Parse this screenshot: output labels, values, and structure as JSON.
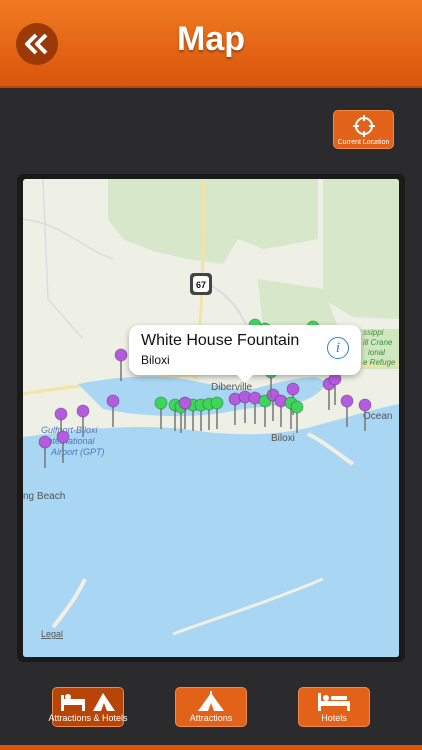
{
  "header": {
    "title": "Map",
    "back_icon": "double-chevron-left-icon"
  },
  "toolbar": {
    "current_location_label": "Current Location",
    "current_location_icon": "crosshair-icon"
  },
  "map": {
    "labels": {
      "highway": "67",
      "diberville": "Diberville",
      "biloxi": "Biloxi",
      "airport_line1": "Gulfport-Biloxi",
      "airport_line2": "International",
      "airport_line3": "Airport (GPT)",
      "long_beach": "ng Beach",
      "ocean": "Ocean",
      "refuge_line1": "ssippi",
      "refuge_line2": "ill Crane",
      "refuge_line3": "ional",
      "refuge_line4": "e Refuge",
      "legal": "Legal"
    },
    "callout": {
      "title": "White House Fountain",
      "subtitle": "Biloxi",
      "info_icon": "info-icon"
    }
  },
  "tabs": [
    {
      "label": "Attractions & Hotels",
      "icon": "bed-tent-icon",
      "active": true
    },
    {
      "label": "Attractions",
      "icon": "tent-icon",
      "active": false
    },
    {
      "label": "Hotels",
      "icon": "bed-icon",
      "active": false
    }
  ],
  "colors": {
    "accent": "#e2621a",
    "header": "#f07a22",
    "pin_purple": "#b45be0",
    "pin_green": "#3dd65a",
    "water": "#a9d6f2",
    "land": "#eef0e6"
  }
}
